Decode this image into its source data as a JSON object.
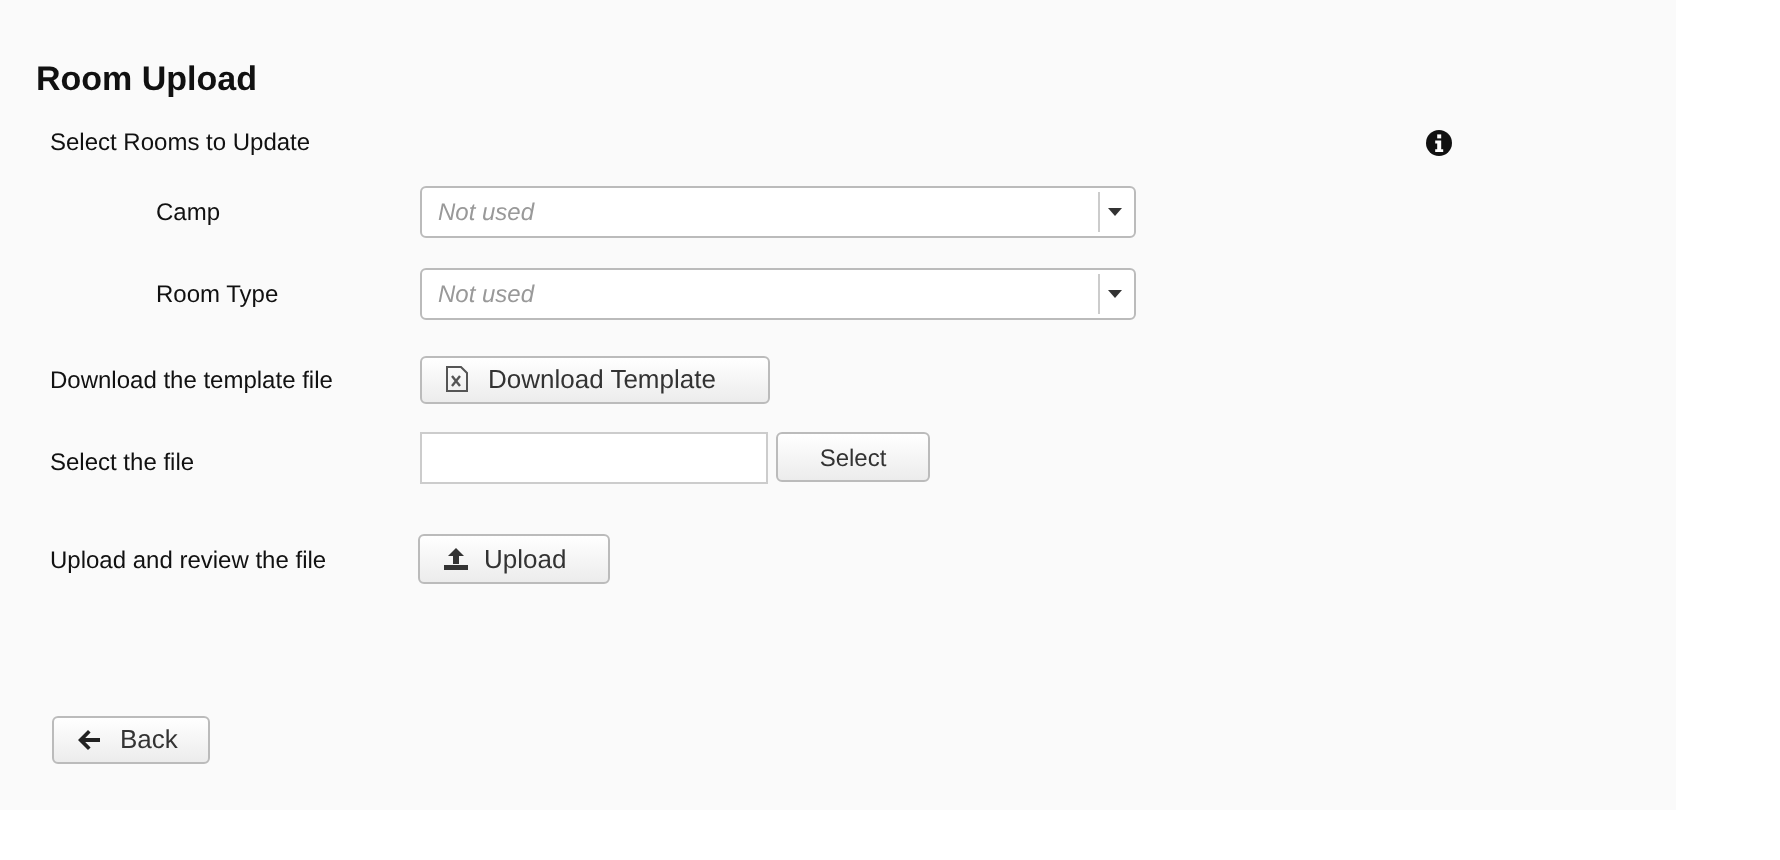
{
  "title": "Room Upload",
  "section_label": "Select Rooms to Update",
  "filters": [
    {
      "label": "Camp",
      "placeholder": "Not used"
    },
    {
      "label": "Room Type",
      "placeholder": "Not used"
    }
  ],
  "download_row": {
    "label": "Download the template file",
    "button": "Download Template"
  },
  "file_row": {
    "label": "Select the file",
    "button": "Select"
  },
  "upload_row": {
    "label": "Upload and review the file",
    "button": "Upload"
  },
  "back_button": "Back"
}
